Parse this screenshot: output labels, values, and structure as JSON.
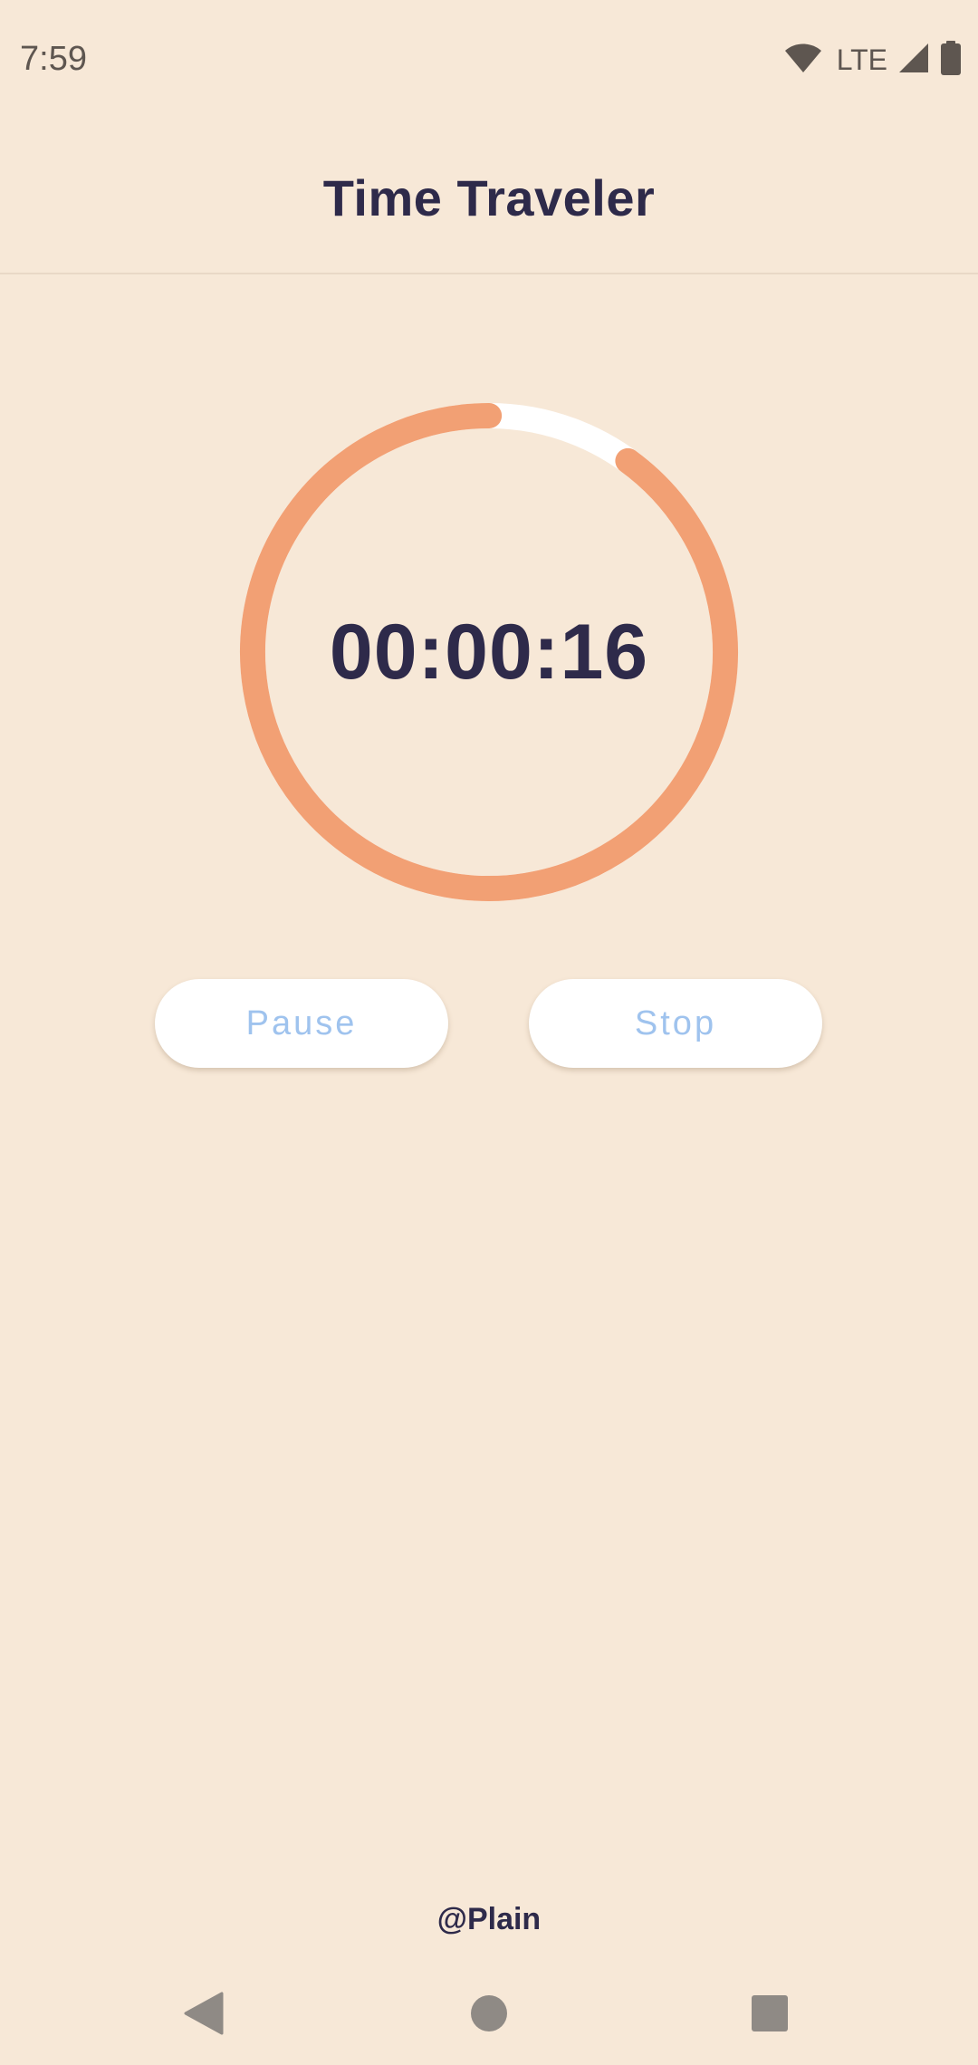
{
  "status_bar": {
    "time": "7:59",
    "network": "LTE",
    "icons": [
      "wifi-icon",
      "signal-icon",
      "battery-icon"
    ],
    "icon_color": "#5E5650"
  },
  "app_bar": {
    "title": "Time Traveler"
  },
  "timer": {
    "display": "00:00:16",
    "progress_fraction": 0.9,
    "progress_color": "#F2A074",
    "track_color": "#FFFFFF",
    "text_color": "#2E2A4A"
  },
  "buttons": {
    "pause_label": "Pause",
    "stop_label": "Stop",
    "label_color": "#9FC3EE",
    "background": "#FFFFFF"
  },
  "footer": {
    "handle": "@Plain"
  },
  "nav_bar": {
    "icons": [
      "back-icon",
      "home-icon",
      "recents-icon"
    ]
  },
  "colors": {
    "background": "#F7E8D7",
    "divider": "#E9D8C6"
  }
}
